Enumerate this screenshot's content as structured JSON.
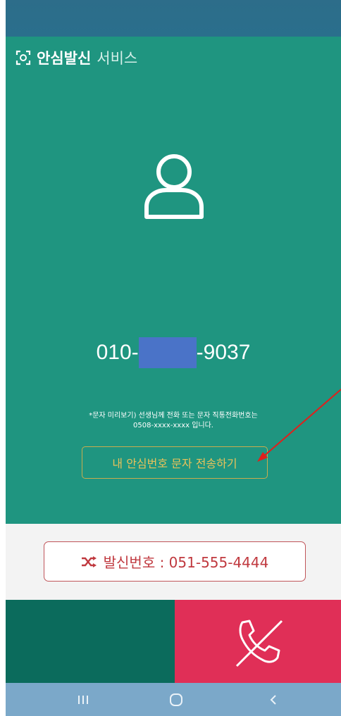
{
  "app": {
    "brand_main": "안심발신",
    "brand_sub": "서비스",
    "icon": "scan-frame-icon"
  },
  "contact": {
    "avatar_icon": "person-icon",
    "phone_prefix": "010-",
    "phone_suffix": "-9037"
  },
  "notice": {
    "line1": "*문자 미리보기) 선생님께 전화 또는 문자 직통전화번호는",
    "line2": "0508-xxxx-xxxx 입니다."
  },
  "send_button": {
    "label": "내 안심번호 문자 전송하기"
  },
  "caller_id": {
    "icon": "shuffle-icon",
    "label": "발신번호 : 051-555-4444"
  },
  "actions": {
    "hangup_icon": "call-end-icon"
  },
  "nav": {
    "recents": "recent-apps-icon",
    "home": "home-icon",
    "back": "back-icon"
  },
  "colors": {
    "main_bg": "#1f9580",
    "status_bg": "#2c6a86",
    "accent_gold": "#e8c25a",
    "caller_red": "#c0393f",
    "hangup_bg": "#e02f57",
    "left_action_bg": "#0b6b5c",
    "nav_bg": "#7ba8c9",
    "mask_blue": "#4a73c8"
  }
}
